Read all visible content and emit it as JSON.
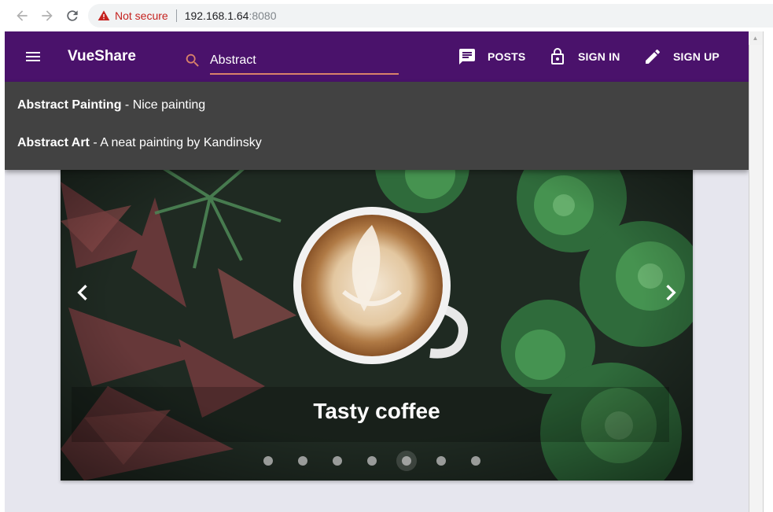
{
  "browser": {
    "security_label": "Not secure",
    "url_host": "192.168.1.64",
    "url_port": ":8080"
  },
  "toolbar": {
    "brand": "VueShare",
    "search_value": "Abstract",
    "nav": [
      {
        "label": "POSTS",
        "icon": "message-icon"
      },
      {
        "label": "SIGN IN",
        "icon": "lock-icon"
      },
      {
        "label": "SIGN UP",
        "icon": "pencil-icon"
      }
    ]
  },
  "search_results": [
    {
      "title": "Abstract Painting",
      "description": " - Nice painting"
    },
    {
      "title": "Abstract Art",
      "description": " - A neat painting by Kandinsky"
    }
  ],
  "carousel": {
    "caption": "Tasty coffee",
    "slide_count": 7,
    "active_index": 4
  },
  "colors": {
    "toolbar": "#4a126b",
    "dropdown": "#424242",
    "search_underline": "#d9826a",
    "page_background": "#e6e6ee"
  }
}
